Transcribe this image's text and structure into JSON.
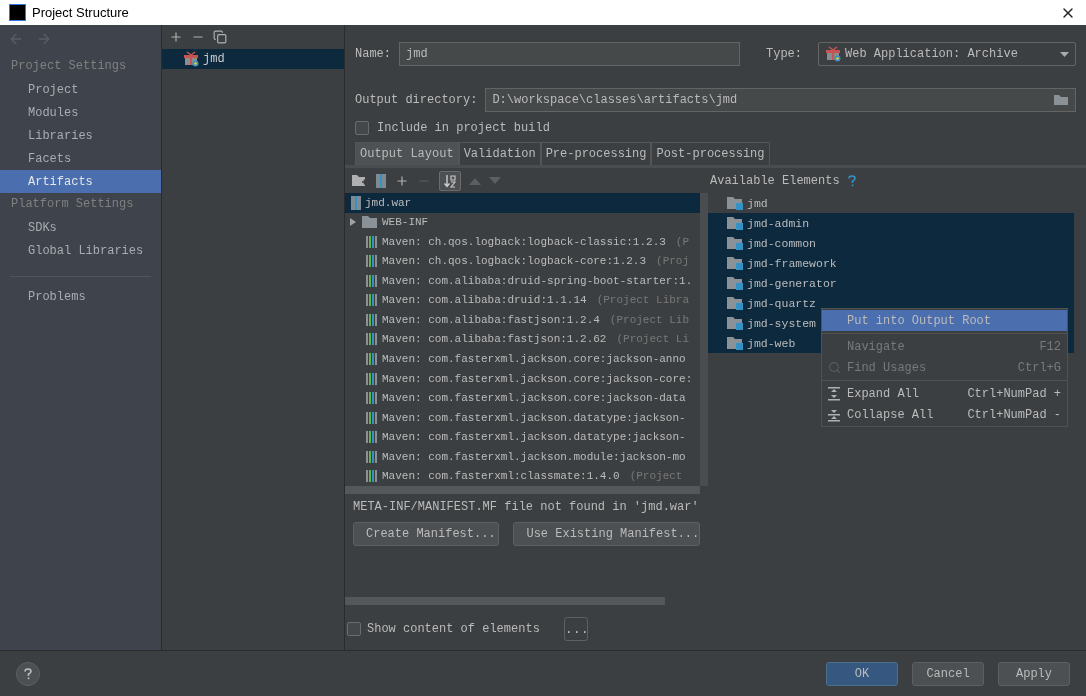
{
  "window": {
    "title": "Project Structure"
  },
  "sidebar": {
    "sections": [
      {
        "title": "Project Settings",
        "items": [
          {
            "label": "Project",
            "selected": false
          },
          {
            "label": "Modules",
            "selected": false
          },
          {
            "label": "Libraries",
            "selected": false
          },
          {
            "label": "Facets",
            "selected": false
          },
          {
            "label": "Artifacts",
            "selected": true
          }
        ]
      },
      {
        "title": "Platform Settings",
        "items": [
          {
            "label": "SDKs",
            "selected": false
          },
          {
            "label": "Global Libraries",
            "selected": false
          }
        ]
      }
    ],
    "extra_items": [
      {
        "label": "Problems",
        "selected": false
      }
    ]
  },
  "artifacts": [
    {
      "name": "jmd",
      "selected": true
    }
  ],
  "name_field": {
    "label": "Name:",
    "value": "jmd"
  },
  "type_field": {
    "label": "Type:",
    "value": "Web Application: Archive"
  },
  "output_directory": {
    "label": "Output directory:",
    "value": "D:\\workspace\\classes\\artifacts\\jmd"
  },
  "include_in_build": {
    "label": "Include in project build",
    "checked": false
  },
  "tabs": [
    {
      "label": "Output Layout",
      "selected": true
    },
    {
      "label": "Validation",
      "selected": false
    },
    {
      "label": "Pre-processing",
      "selected": false
    },
    {
      "label": "Post-processing",
      "selected": false
    }
  ],
  "output_layout": {
    "rows": [
      {
        "kind": "archive",
        "label": "jmd.war",
        "selected": true
      },
      {
        "kind": "folder",
        "label": "WEB-INF",
        "expanded": false,
        "selected": false
      },
      {
        "kind": "library",
        "label": "Maven: ch.qos.logback:logback-classic:1.2.3",
        "suffix": "(P",
        "selected": false
      },
      {
        "kind": "library",
        "label": "Maven: ch.qos.logback:logback-core:1.2.3",
        "suffix": "(Proj",
        "selected": false
      },
      {
        "kind": "library",
        "label": "Maven: com.alibaba:druid-spring-boot-starter:1.",
        "selected": false
      },
      {
        "kind": "library",
        "label": "Maven: com.alibaba:druid:1.1.14",
        "suffix": "(Project Libra",
        "selected": false
      },
      {
        "kind": "library",
        "label": "Maven: com.alibaba:fastjson:1.2.4",
        "suffix": "(Project Lib",
        "selected": false
      },
      {
        "kind": "library",
        "label": "Maven: com.alibaba:fastjson:1.2.62",
        "suffix": "(Project Li",
        "selected": false
      },
      {
        "kind": "library",
        "label": "Maven: com.fasterxml.jackson.core:jackson-anno",
        "selected": false
      },
      {
        "kind": "library",
        "label": "Maven: com.fasterxml.jackson.core:jackson-core:",
        "selected": false
      },
      {
        "kind": "library",
        "label": "Maven: com.fasterxml.jackson.core:jackson-data",
        "selected": false
      },
      {
        "kind": "library",
        "label": "Maven: com.fasterxml.jackson.datatype:jackson-",
        "selected": false
      },
      {
        "kind": "library",
        "label": "Maven: com.fasterxml.jackson.datatype:jackson-",
        "selected": false
      },
      {
        "kind": "library",
        "label": "Maven: com.fasterxml.jackson.module:jackson-mo",
        "selected": false
      },
      {
        "kind": "library",
        "label": "Maven: com.fasterxml:classmate:1.4.0",
        "suffix": "(Project",
        "selected": false
      }
    ],
    "manifest_message": "META-INF/MANIFEST.MF file not found in 'jmd.war'",
    "manifest_buttons": [
      "Create Manifest...",
      "Use Existing Manifest..."
    ]
  },
  "available_elements": {
    "title": "Available Elements",
    "items": [
      {
        "label": "jmd",
        "selected": false
      },
      {
        "label": "jmd-admin",
        "selected": true
      },
      {
        "label": "jmd-common",
        "selected": true
      },
      {
        "label": "jmd-framework",
        "selected": true
      },
      {
        "label": "jmd-generator",
        "selected": true
      },
      {
        "label": "jmd-quartz",
        "selected": true
      },
      {
        "label": "jmd-system",
        "selected": true
      },
      {
        "label": "jmd-web",
        "selected": true
      }
    ]
  },
  "context_menu": [
    {
      "kind": "action",
      "label": "Put into Output Root",
      "selected": true,
      "disabled": false
    },
    {
      "kind": "separator"
    },
    {
      "kind": "action",
      "label": "Navigate",
      "shortcut": "F12",
      "selected": false,
      "disabled": true
    },
    {
      "kind": "search",
      "label": "Find Usages",
      "shortcut": "Ctrl+G",
      "selected": false,
      "disabled": true
    },
    {
      "kind": "separator"
    },
    {
      "kind": "expand",
      "label": "Expand All",
      "shortcut": "Ctrl+NumPad +",
      "selected": false,
      "disabled": false
    },
    {
      "kind": "collapse",
      "label": "Collapse All",
      "shortcut": "Ctrl+NumPad -",
      "selected": false,
      "disabled": false
    }
  ],
  "show_content": {
    "label": "Show content of elements",
    "checked": false,
    "button": "..."
  },
  "buttons": [
    {
      "label": "OK",
      "kind": "primary"
    },
    {
      "label": "Cancel",
      "kind": "normal"
    },
    {
      "label": "Apply",
      "kind": "normal"
    }
  ]
}
